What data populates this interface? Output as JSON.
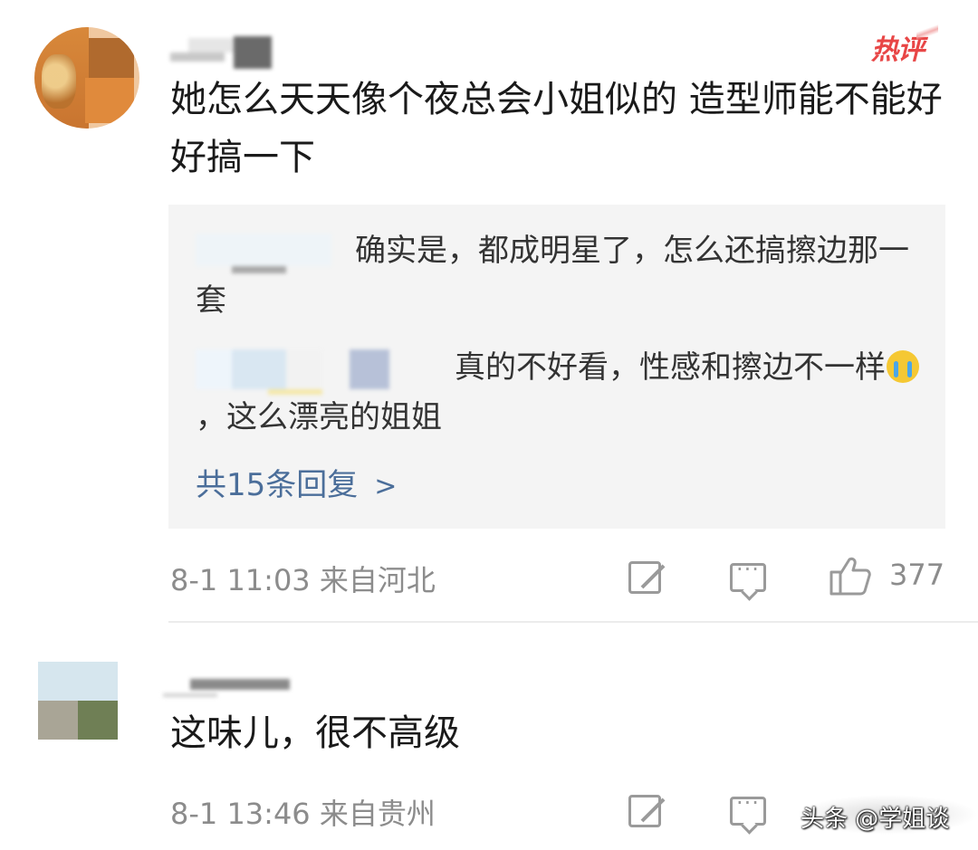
{
  "comments": [
    {
      "badge": "热评",
      "text": "她怎么天天像个夜总会小姐似的 造型师能不能好好搞一下",
      "replies": [
        {
          "text": "确实是，都成明星了，怎么还搞擦边那一套"
        },
        {
          "text_before_emoji": "真的不好看，性感和擦边不一样",
          "emoji": "crying-face-emoji",
          "text_after_emoji": "，这么漂亮的姐姐"
        }
      ],
      "more_replies": "共15条回复",
      "time": "8-1 11:03",
      "location": "来自河北",
      "likes": "377"
    },
    {
      "text": "这味儿，很不高级",
      "time": "8-1 13:46",
      "location": "来自贵州"
    }
  ],
  "watermark": "头条 @学姐谈",
  "colors": {
    "badge": "#e84646",
    "link": "#4b6e9a",
    "meta": "#8c8c8c",
    "reply_bg": "#f4f4f4"
  }
}
